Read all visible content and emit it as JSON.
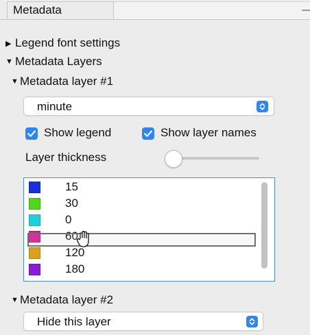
{
  "panel": {
    "tab_title": "Metadata"
  },
  "tree": {
    "legend_font_settings": "Legend font settings",
    "metadata_layers": "Metadata Layers",
    "layer1": {
      "title": "Metadata layer #1",
      "dropdown_value": "minute",
      "show_legend_label": "Show legend",
      "show_legend_checked": true,
      "show_layer_names_label": "Show layer names",
      "show_layer_names_checked": true,
      "layer_thickness_label": "Layer thickness",
      "layer_thickness_level": 0.0,
      "legend_items": [
        {
          "value": "15",
          "color": "#1733d8"
        },
        {
          "value": "30",
          "color": "#52d61c"
        },
        {
          "value": "0",
          "color": "#1ed2dc"
        },
        {
          "value": "60",
          "color": "#dc1c9a"
        },
        {
          "value": "120",
          "color": "#d9a11c"
        },
        {
          "value": "180",
          "color": "#8a1cd6"
        }
      ]
    },
    "layer2": {
      "title": "Metadata layer #2",
      "dropdown_value": "Hide this layer"
    }
  },
  "icons": {
    "collapsed": "triangle-right-icon",
    "expanded": "triangle-down-icon",
    "stepper": "updown-chevron-icon",
    "checkmark": "checkmark-icon",
    "cursor": "open-hand-cursor-icon"
  },
  "colors": {
    "accent": "#2e86ee",
    "selection_border": "#4d8bd8"
  }
}
